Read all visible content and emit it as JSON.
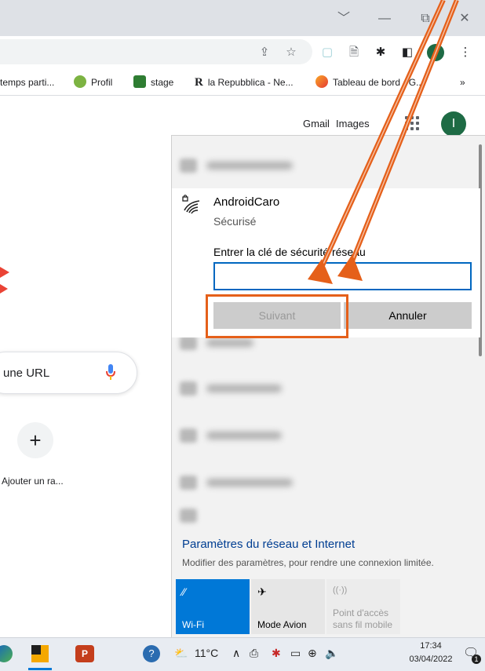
{
  "browser": {
    "window_controls": {
      "dropdown": "﹀",
      "minimize": "—",
      "restore": "⧉",
      "close": "✕"
    },
    "toolbar": {
      "share": "⇪",
      "star": "☆",
      "ext1": "▢",
      "ext2": "🗎",
      "puzzle": "✱",
      "sidepanel": "◧",
      "menu": "⋮"
    },
    "bookmarks": [
      {
        "label": "temps parti...",
        "color": "#ffffff"
      },
      {
        "label": "Profil",
        "color": "#7cb342"
      },
      {
        "label": "stage",
        "color": "#2e7d32"
      },
      {
        "label": "la Repubblica - Ne...",
        "icon_text": "R",
        "color": "#ffffff"
      },
      {
        "label": "Tableau de bord - G...",
        "color": "#f9a825"
      }
    ],
    "bookmarks_more": "»"
  },
  "google": {
    "gmail": "Gmail",
    "images": "Images",
    "avatar_letter": "I",
    "search_placeholder": "une URL",
    "shortcut_plus": "+",
    "shortcut_label": "Ajouter un ra..."
  },
  "network_flyout": {
    "selected": {
      "name": "AndroidCaro",
      "security": "Sécurisé",
      "key_label": "Entrer la clé de sécurité réseau",
      "key_value": "",
      "next_button": "Suivant",
      "cancel_button": "Annuler"
    },
    "settings_title": "Paramètres du réseau et Internet",
    "settings_subtitle": "Modifier des paramètres, pour rendre une connexion limitée.",
    "tiles": [
      {
        "label": "Wi-Fi",
        "icon": "wifi-icon",
        "active": true
      },
      {
        "label": "Mode Avion",
        "icon": "airplane-icon",
        "active": false
      },
      {
        "label": "Point d'accès sans fil mobile",
        "line1": "Point d'accès",
        "line2": "sans fil mobile",
        "icon": "hotspot-icon",
        "active": false,
        "disabled": true
      }
    ]
  },
  "taskbar": {
    "weather": "11°C",
    "clock_time": "17:34",
    "clock_date": "03/04/2022",
    "notification_count": "1"
  },
  "colors": {
    "accent": "#0078d7",
    "highlight": "#e5601a",
    "link_blue": "#003e92",
    "google_avatar": "#1e6b45"
  }
}
